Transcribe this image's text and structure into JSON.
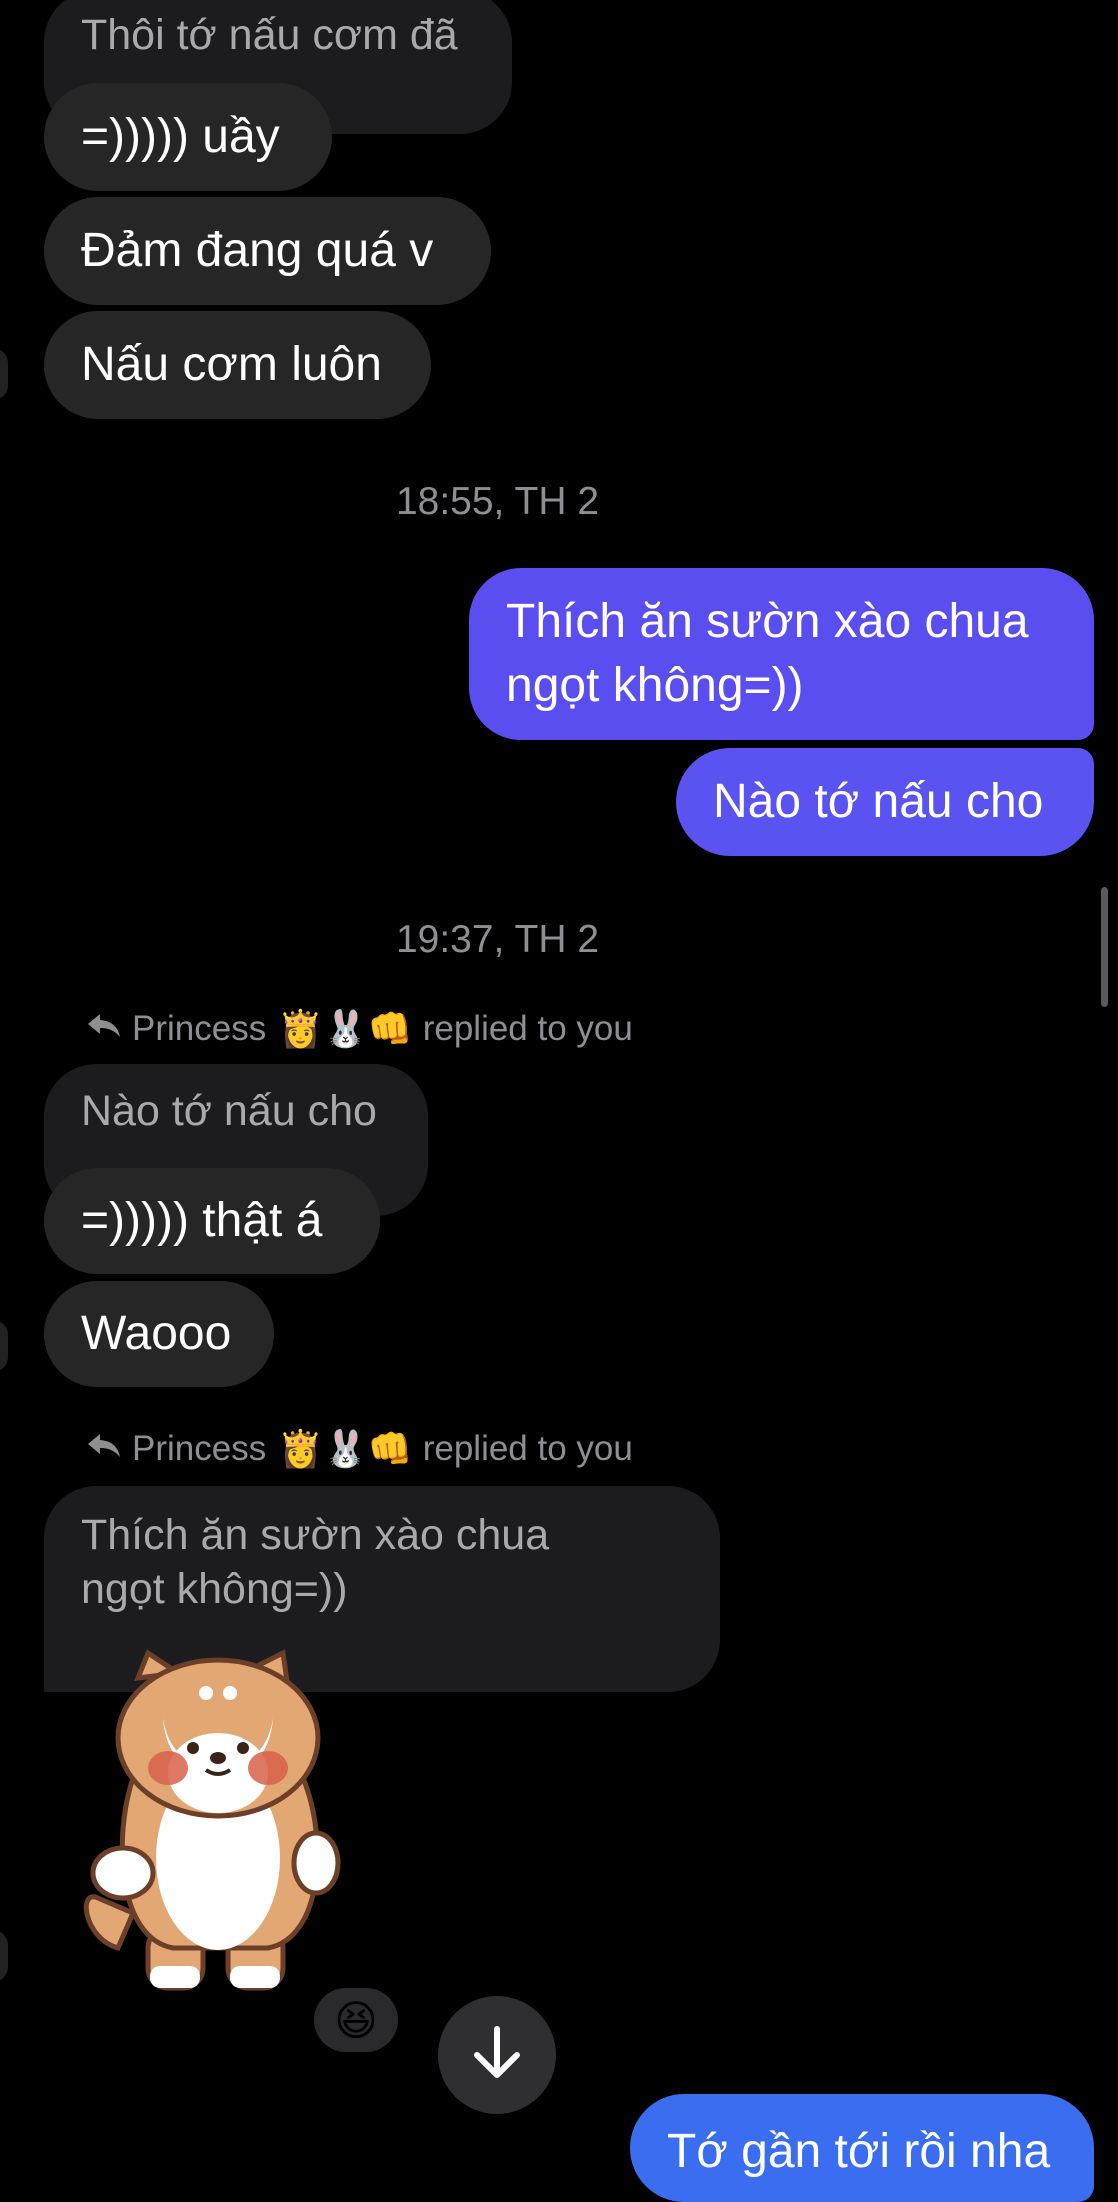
{
  "messages": {
    "m1": "Thôi tớ nấu cơm đã",
    "m2": "=))))) uầy",
    "m3": "Đảm đang quá v",
    "m4": "Nấu cơm luôn",
    "t1": "18:55, TH 2",
    "m5_line1": "Thích ăn sườn xào chua",
    "m5_line2": "ngọt không=))",
    "m6": "Nào tớ nấu cho",
    "t2": "19:37, TH 2",
    "reply1": {
      "name": "Princess",
      "emojis": "👸🐰👊",
      "action": "replied to you",
      "quoted": "Nào tớ nấu cho"
    },
    "m7": "=))))) thật á",
    "m8": "Waooo",
    "reply2": {
      "name": "Princess",
      "emojis": "👸🐰👊",
      "action": "replied to you",
      "quoted_line1": "Thích ăn sườn xào chua",
      "quoted_line2": "ngọt không=))"
    },
    "reaction": "😆",
    "m9": "Tớ gần tới rồi nha"
  },
  "icons": {
    "reply": "reply-arrow-icon",
    "scroll_down": "arrow-down-icon",
    "sticker": "shiba-dog-sticker"
  },
  "colors": {
    "background": "#000000",
    "incoming_bubble": "#262626",
    "quoted_bubble": "#1c1c1e",
    "outgoing_purple": "#5b4ef0",
    "outgoing_blue": "#3a6df0",
    "timestamp": "#8e8e93"
  }
}
